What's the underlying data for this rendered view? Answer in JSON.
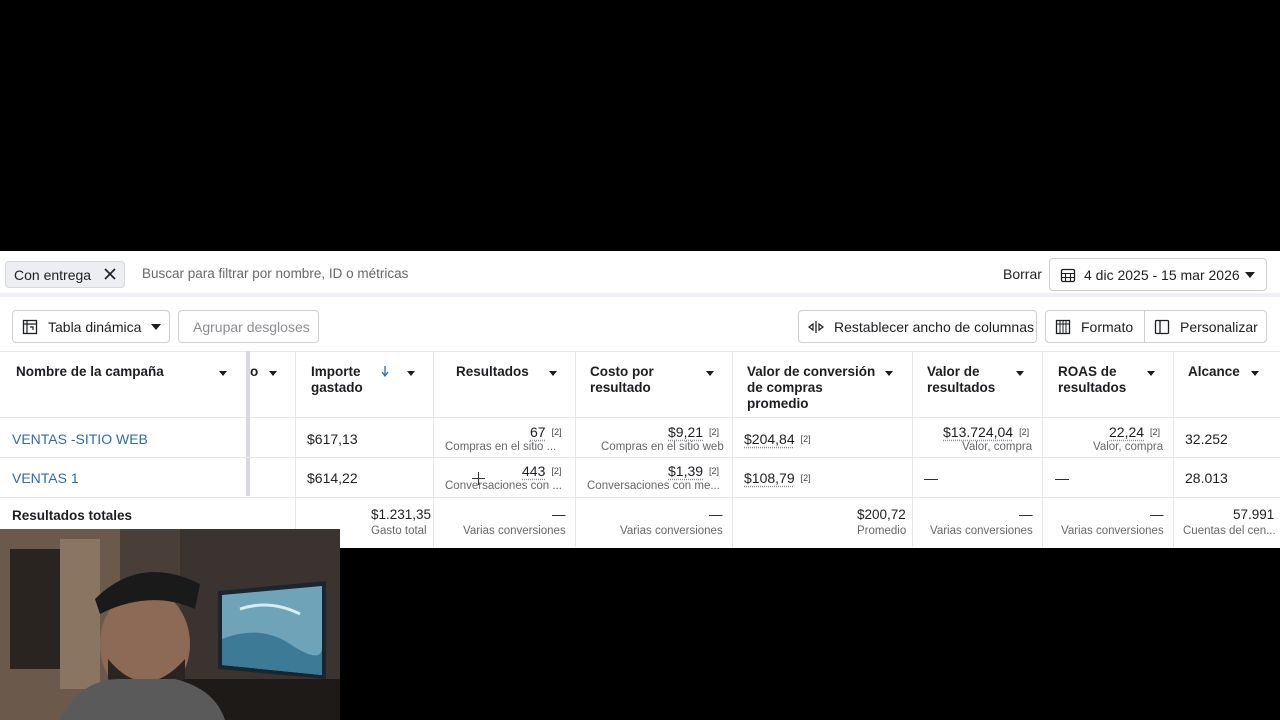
{
  "filters": {
    "chip_label": "Con entrega",
    "search_placeholder": "Buscar para filtrar por nombre, ID o métricas",
    "clear_label": "Borrar",
    "date_range": "4 dic 2025 - 15 mar 2026"
  },
  "toolbar": {
    "pivot_label": "Tabla dinámica",
    "group_label": "Agrupar desgloses",
    "reset_widths_label": "Restablecer ancho de columnas",
    "format_label": "Formato",
    "customize_label": "Personalizar"
  },
  "columns": {
    "campaign_name": "Nombre de la campaña",
    "partial": "o",
    "spent_l1": "Importe",
    "spent_l2": "gastado",
    "results": "Resultados",
    "cost_l1": "Costo por",
    "cost_l2": "resultado",
    "conv_l1": "Valor de conversión",
    "conv_l2": "de compras",
    "conv_l3": "promedio",
    "value_l1": "Valor de",
    "value_l2": "resultados",
    "roas_l1": "ROAS de",
    "roas_l2": "resultados",
    "reach": "Alcance"
  },
  "rows": [
    {
      "name": "VENTAS -SITIO WEB",
      "spent": "$617,13",
      "results": "67",
      "results_badge": "[2]",
      "results_sub": "Compras en el sitio ...",
      "cost": "$9,21",
      "cost_badge": "[2]",
      "cost_sub": "Compras en el sitio web",
      "conv": "$204,84",
      "conv_badge": "[2]",
      "value": "$13.724,04",
      "value_badge": "[2]",
      "value_sub": "Valor, compra",
      "roas": "22,24",
      "roas_badge": "[2]",
      "roas_sub": "Valor, compra",
      "reach": "32.252"
    },
    {
      "name": "VENTAS 1",
      "spent": "$614,22",
      "results": "443",
      "results_badge": "[2]",
      "results_sub": "Conversaciones con ...",
      "cost": "$1,39",
      "cost_badge": "[2]",
      "cost_sub": "Conversaciones con me...",
      "conv": "$108,79",
      "conv_badge": "[2]",
      "value": "—",
      "roas": "—",
      "reach": "28.013"
    }
  ],
  "totals": {
    "label": "Resultados totales",
    "spent": "$1.231,35",
    "spent_sub": "Gasto total",
    "results": "—",
    "results_sub": "Varias conversiones",
    "cost": "—",
    "cost_sub": "Varias conversiones",
    "conv": "$200,72",
    "conv_sub": "Promedio",
    "value": "—",
    "value_sub": "Varias conversiones",
    "roas": "—",
    "roas_sub": "Varias conversiones",
    "reach": "57.991",
    "reach_sub": "Cuentas del cen..."
  },
  "colors": {
    "link": "#2f6ca3",
    "border": "#e4e6eb",
    "text": "#1c1e21",
    "muted": "#65676b"
  }
}
